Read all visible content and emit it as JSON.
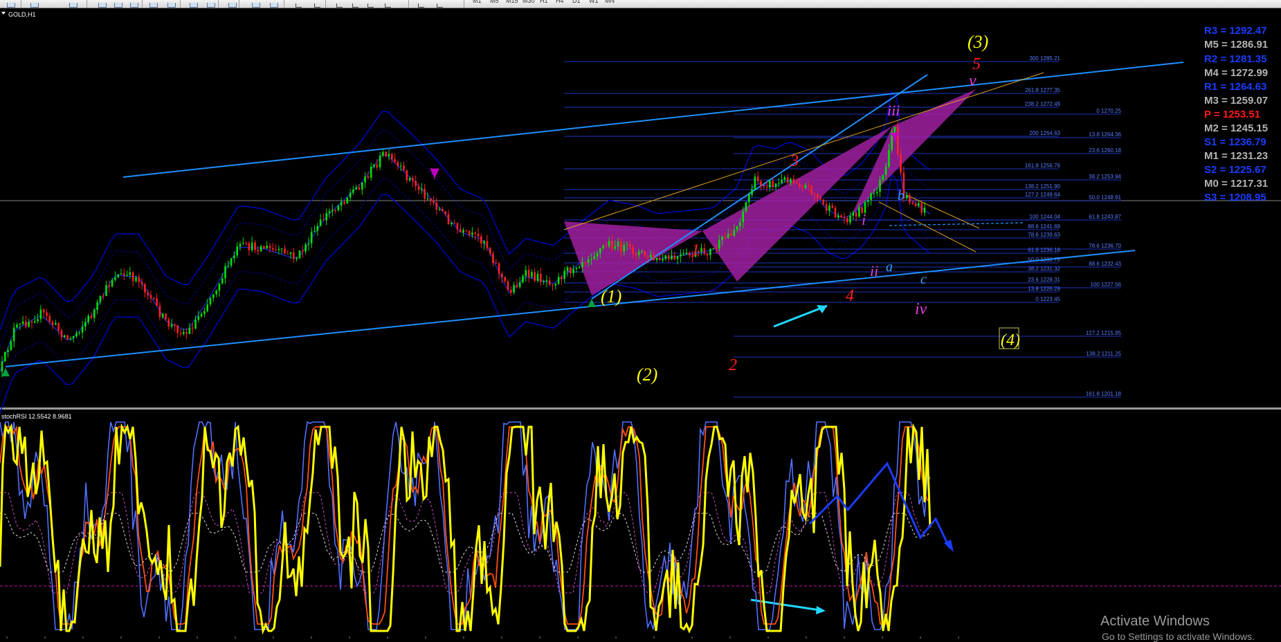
{
  "window": {
    "symbol_label": "GOLD,H1"
  },
  "timeframes": [
    "M1",
    "M5",
    "M15",
    "M30",
    "H1",
    "H4",
    "D1",
    "W1",
    "MN"
  ],
  "tools": [
    "cursor-icon",
    "crosshair-icon",
    "vertical-line-icon",
    "horizontal-line-icon",
    "trendline-icon",
    "text-icon",
    "label-icon",
    "shapes-icon"
  ],
  "toolbar_icons": [
    "new-order-icon",
    "profiles-icon",
    "market-watch-icon",
    "data-window-icon",
    "navigator-icon",
    "zoom-in-icon",
    "zoom-out-icon",
    "tile-icon",
    "autoscroll-icon",
    "chart-shift-icon",
    "indicators-icon",
    "periods-icon",
    "templates-icon"
  ],
  "pivot": {
    "R3": {
      "label": "R3 = 1292.47",
      "color": "#1a3cff"
    },
    "M5": {
      "label": "M5 = 1286.91",
      "color": "#b4b4b4"
    },
    "R2": {
      "label": "R2 = 1281.35",
      "color": "#1a3cff"
    },
    "M4": {
      "label": "M4 = 1272.99",
      "color": "#b4b4b4"
    },
    "R1": {
      "label": "R1 = 1264.63",
      "color": "#1a3cff"
    },
    "M3": {
      "label": "M3 = 1259.07",
      "color": "#b4b4b4"
    },
    "P": {
      "label": "P   = 1253.51",
      "color": "#ff1a1a"
    },
    "M2": {
      "label": "M2 = 1245.15",
      "color": "#b4b4b4"
    },
    "S1": {
      "label": "S1 = 1236.79",
      "color": "#1a3cff"
    },
    "M1": {
      "label": "M1 = 1231.23",
      "color": "#b4b4b4"
    },
    "S2": {
      "label": "S2 = 1225.67",
      "color": "#1a3cff"
    },
    "M0": {
      "label": "M0 = 1217.31",
      "color": "#b4b4b4"
    },
    "S3": {
      "label": "S3 = 1208.95",
      "color": "#1a3cff"
    }
  },
  "fib_a": [
    "300 1285.21",
    "261.8 1277.35",
    "238.2 1272.49",
    "200 1264.63",
    "161.8 1256.76",
    "138.2 1251.90",
    "127.2 1249.64",
    "100 1244.04",
    "88.6 1241.69",
    "78.6 1239.63",
    "61.8 1236.18",
    "50.0 1233.75",
    "38.2 1231.32",
    "23.6 1228.31",
    "13.8 1226.29",
    "0 1223.45"
  ],
  "fib_b": [
    "0 1270.25",
    "13.8 1264.36",
    "23.6 1260.18",
    "38.2 1253.94",
    "50.0 1248.91",
    "61.8 1243.87",
    "78.6 1236.70",
    "88.6 1232.43",
    "100 1227.56",
    "127.2 1215.95",
    "138.2 1211.25",
    "161.8 1201.18"
  ],
  "waves": {
    "w1": "(1)",
    "w2": "(2)",
    "w3": "(3)",
    "w4": "(4)",
    "i1": "1",
    "i2": "2",
    "i3": "3",
    "i4": "4",
    "i5": "5",
    "m1": "i",
    "m2": "ii",
    "m3": "iii",
    "m4": "iv",
    "m5": "v",
    "a": "a",
    "b": "b",
    "c": "c"
  },
  "indicator": {
    "label": "stochRSI 12.5542 8.9681"
  },
  "watermark": {
    "title": "Activate Windows",
    "sub": "Go to Settings to activate Windows."
  },
  "colors": {
    "bull": "#00e000",
    "bear": "#ff2020",
    "channel": "#1e90ff",
    "envelope": "#0000d0",
    "pattern": "#a020a0",
    "yellow": "#ffff00",
    "fibline": "#2545ff",
    "fibtext": "#5a7bff"
  }
}
